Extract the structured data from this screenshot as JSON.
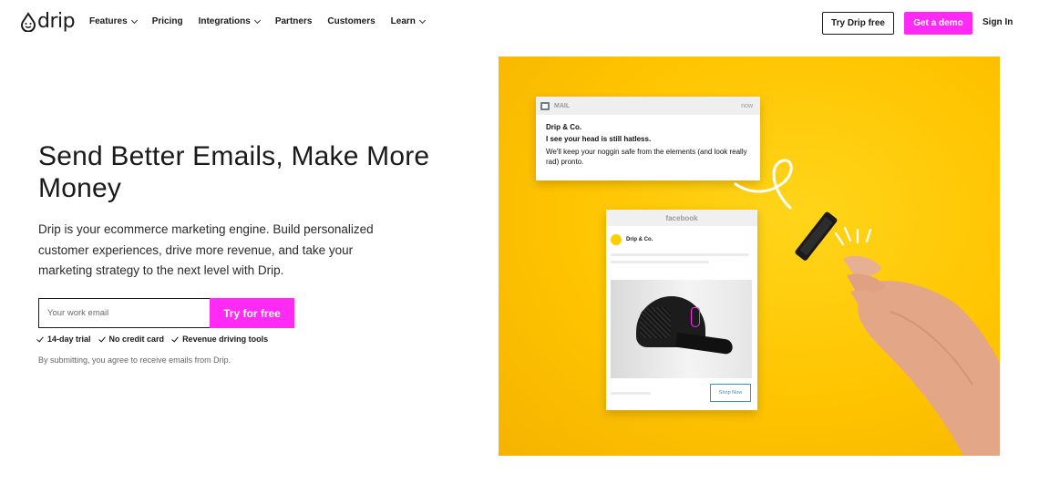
{
  "nav": {
    "logo_text": "drip",
    "links": [
      {
        "label": "Features"
      },
      {
        "label": "Pricing"
      },
      {
        "label": "Integrations"
      },
      {
        "label": "Partners"
      },
      {
        "label": "Customers"
      },
      {
        "label": "Learn"
      }
    ],
    "try_free": "Try Drip free",
    "get_demo": "Get a demo",
    "sign_in": "Sign In"
  },
  "hero": {
    "title": "Send Better Emails, Make More Money",
    "description": "Drip is your ecommerce marketing engine. Build personalized customer experiences, drive more revenue, and take your marketing strategy to the next level with Drip.",
    "email_placeholder": "Your work email",
    "cta": "Try for free",
    "checks": [
      "14-day trial",
      "No credit card",
      "Revenue driving tools"
    ],
    "disclaimer": "By submitting, you agree to receive emails from Drip."
  },
  "illustration": {
    "mail": {
      "app": "MAIL",
      "time": "now",
      "from": "Drip & Co.",
      "subject": "I see your head is still hatless.",
      "body": "We'll keep your noggin safe from the elements (and look really rad) pronto."
    },
    "facebook": {
      "app": "facebook",
      "brand": "Drip & Co.",
      "shop_button": "Shop Now"
    }
  },
  "colors": {
    "accent": "#ff2bf5",
    "hero_background": "#ffc400"
  }
}
